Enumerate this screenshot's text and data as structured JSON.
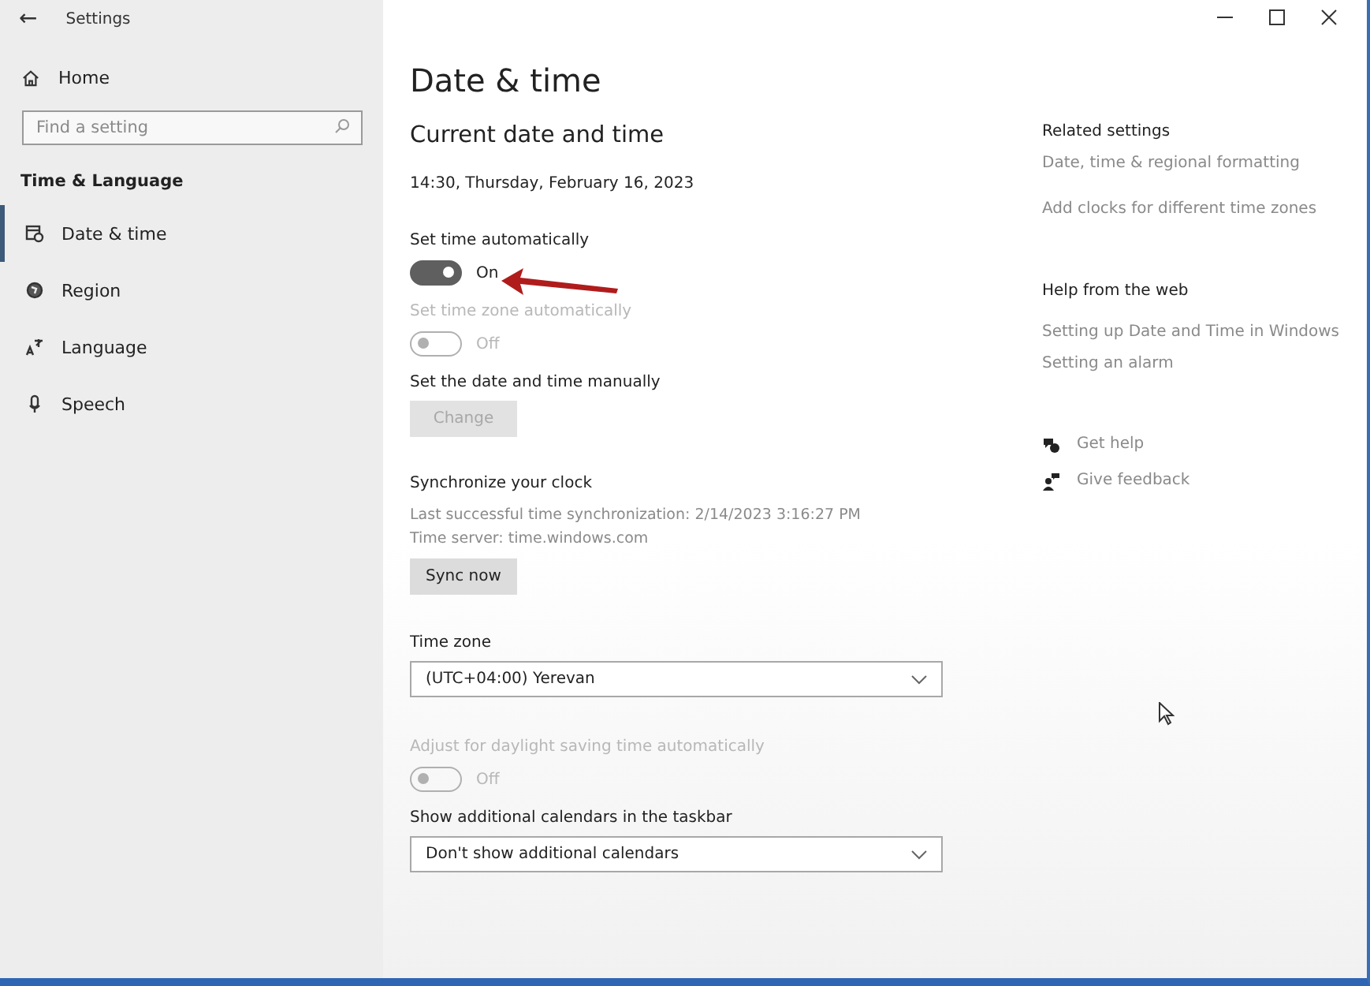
{
  "window": {
    "title": "Settings",
    "back": "←"
  },
  "sidebar": {
    "home": "Home",
    "search": {
      "placeholder": "Find a setting"
    },
    "section": "Time & Language",
    "items": [
      {
        "label": "Date & time",
        "kind": "calendar",
        "selected": true
      },
      {
        "label": "Region",
        "kind": "globe",
        "selected": false
      },
      {
        "label": "Language",
        "kind": "language",
        "selected": false
      },
      {
        "label": "Speech",
        "kind": "mic",
        "selected": false
      }
    ]
  },
  "main": {
    "title": "Date & time",
    "section": "Current date and time",
    "current": "14:30, Thursday, February 16, 2023",
    "settings": [
      {
        "kind": "toggle",
        "label": "Set time automatically",
        "state": "On",
        "on": true,
        "disabled": false
      },
      {
        "kind": "toggle",
        "label": "Set time zone automatically",
        "state": "Off",
        "on": false,
        "disabled": true
      },
      {
        "kind": "button",
        "label": "Set the date and time manually",
        "button": "Change",
        "disabled": true
      },
      {
        "kind": "button",
        "label": "Synchronize your clock",
        "details": [
          "Last successful time synchronization: 2/14/2023 3:16:27 PM",
          "Time server: time.windows.com"
        ],
        "button": "Sync now",
        "disabled": false
      },
      {
        "kind": "dropdown",
        "label": "Time zone",
        "value": "(UTC+04:00) Yerevan"
      },
      {
        "kind": "toggle",
        "label": "Adjust for daylight saving time automatically",
        "state": "Off",
        "on": false,
        "disabled": true
      },
      {
        "kind": "dropdown",
        "label": "Show additional calendars in the taskbar",
        "value": "Don't show additional calendars"
      }
    ]
  },
  "related": {
    "title": "Related settings",
    "links": [
      "Date, time & regional formatting",
      "Add clocks for different time zones"
    ]
  },
  "help": {
    "title": "Help from the web",
    "links": [
      "Setting up Date and Time in Windows",
      "Setting an alarm"
    ]
  },
  "support": [
    {
      "label": "Get help",
      "kind": "help"
    },
    {
      "label": "Give feedback",
      "kind": "feedback"
    }
  ]
}
